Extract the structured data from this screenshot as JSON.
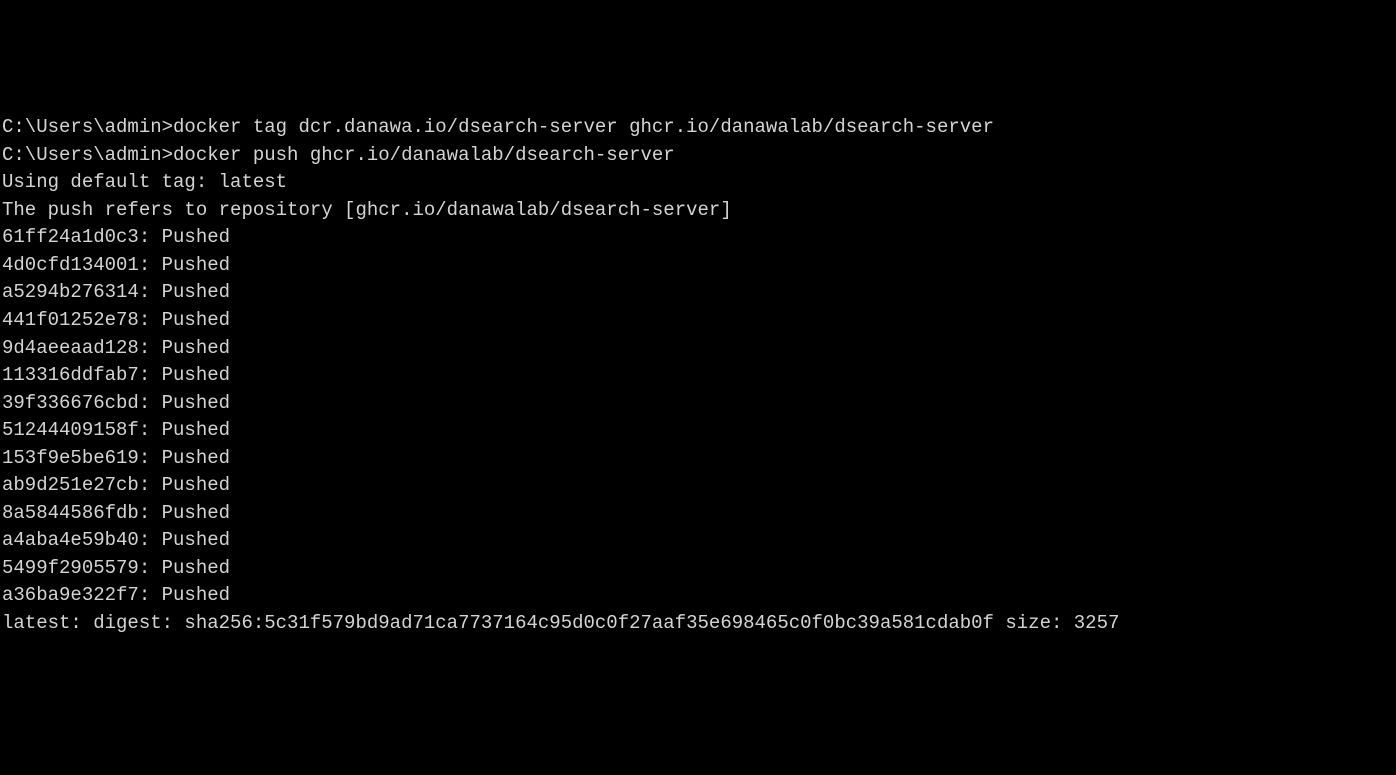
{
  "prompt1": "C:\\Users\\admin>",
  "command1": "docker tag dcr.danawa.io/dsearch-server ghcr.io/danawalab/dsearch-server",
  "blank1": "",
  "prompt2": "C:\\Users\\admin>",
  "command2": "docker push ghcr.io/danawalab/dsearch-server",
  "line_tag": "Using default tag: latest",
  "line_repo": "The push refers to repository [ghcr.io/danawalab/dsearch-server]",
  "layers": [
    "61ff24a1d0c3: Pushed",
    "4d0cfd134001: Pushed",
    "a5294b276314: Pushed",
    "441f01252e78: Pushed",
    "9d4aeeaad128: Pushed",
    "113316ddfab7: Pushed",
    "39f336676cbd: Pushed",
    "51244409158f: Pushed",
    "153f9e5be619: Pushed",
    "ab9d251e27cb: Pushed",
    "8a5844586fdb: Pushed",
    "a4aba4e59b40: Pushed",
    "5499f2905579: Pushed",
    "a36ba9e322f7: Pushed"
  ],
  "digest_line": "latest: digest: sha256:5c31f579bd9ad71ca7737164c95d0c0f27aaf35e698465c0f0bc39a581cdab0f size: 3257"
}
